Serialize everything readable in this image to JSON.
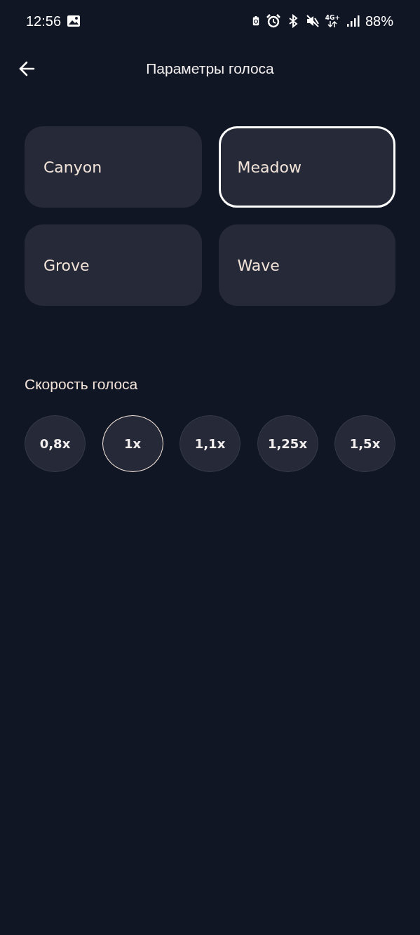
{
  "status_bar": {
    "time": "12:56",
    "network": "4G+",
    "battery": "88%"
  },
  "header": {
    "title": "Параметры голоса"
  },
  "voices": [
    {
      "label": "Canyon",
      "selected": false
    },
    {
      "label": "Meadow",
      "selected": true
    },
    {
      "label": "Grove",
      "selected": false
    },
    {
      "label": "Wave",
      "selected": false
    }
  ],
  "speed": {
    "title": "Скорость голоса",
    "options": [
      {
        "label": "0,8x",
        "selected": false
      },
      {
        "label": "1x",
        "selected": true
      },
      {
        "label": "1,1x",
        "selected": false
      },
      {
        "label": "1,25x",
        "selected": false
      },
      {
        "label": "1,5x",
        "selected": false
      }
    ]
  }
}
